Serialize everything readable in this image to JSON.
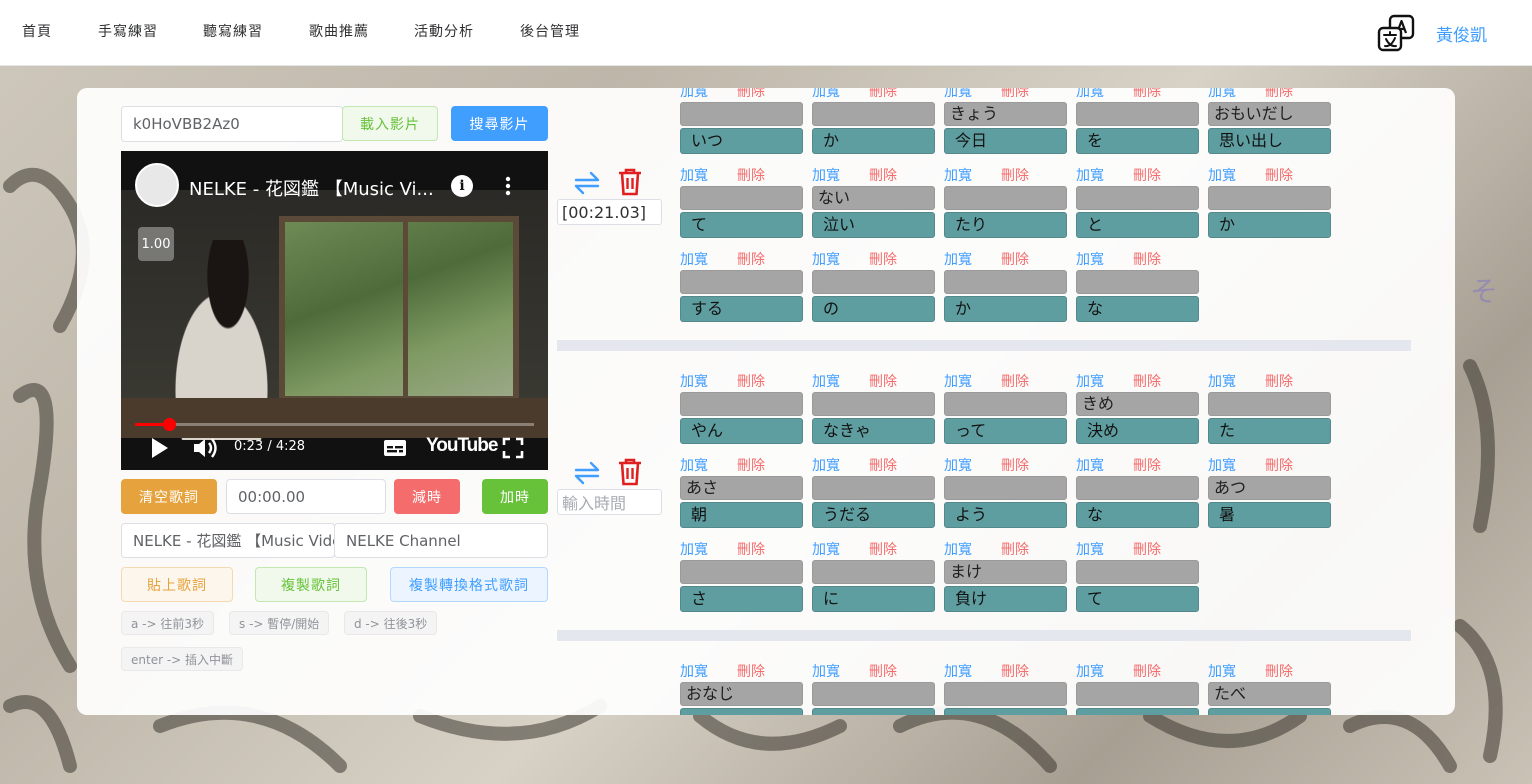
{
  "nav": {
    "items": [
      "首頁",
      "手寫練習",
      "聽寫練習",
      "歌曲推薦",
      "活動分析",
      "後台管理"
    ],
    "user": "黃俊凱"
  },
  "video_controls": {
    "video_id": "k0HoVBB2Az0",
    "load_label": "載入影片",
    "search_label": "搜尋影片",
    "clear_label": "清空歌詞",
    "time_value": "00:00.00",
    "minus_label": "減時",
    "plus_label": "加時",
    "song_title": "NELKE - 花図鑑 【Music Video】",
    "channel": "NELKE Channel",
    "paste_label": "貼上歌詞",
    "copy_label": "複製歌詞",
    "copy_format_label": "複製轉換格式歌詞",
    "shortcuts": [
      "a -> 往前3秒",
      "s -> 暫停/開始",
      "d -> 往後3秒",
      "enter -> 插入中斷"
    ]
  },
  "player": {
    "title": "NELKE - 花図鑑 【Music Vi...",
    "speed": "1.00",
    "time": "0:23 / 4:28",
    "logo": "YouTube",
    "progress_fraction": 0.086
  },
  "lyrics": {
    "widen_label": "加寬",
    "delete_label": "刪除",
    "sections": [
      {
        "time": "[00:21.03]",
        "time_placeholder": "",
        "rows": [
          [
            {
              "reading": "",
              "word": "いつ"
            },
            {
              "reading": "",
              "word": "か"
            },
            {
              "reading": "きょう",
              "word": "今日"
            },
            {
              "reading": "",
              "word": "を"
            },
            {
              "reading": "おもいだし",
              "word": "思い出し"
            }
          ],
          [
            {
              "reading": "",
              "word": "て"
            },
            {
              "reading": "ない",
              "word": "泣い"
            },
            {
              "reading": "",
              "word": "たり"
            },
            {
              "reading": "",
              "word": "と"
            },
            {
              "reading": "",
              "word": "か"
            }
          ],
          [
            {
              "reading": "",
              "word": "する"
            },
            {
              "reading": "",
              "word": "の"
            },
            {
              "reading": "",
              "word": "か"
            },
            {
              "reading": "",
              "word": "な"
            }
          ]
        ]
      },
      {
        "time": "",
        "time_placeholder": "輸入時間",
        "rows": [
          [
            {
              "reading": "",
              "word": "やん"
            },
            {
              "reading": "",
              "word": "なきゃ"
            },
            {
              "reading": "",
              "word": "って"
            },
            {
              "reading": "きめ",
              "word": "決め"
            },
            {
              "reading": "",
              "word": "た"
            }
          ],
          [
            {
              "reading": "あさ",
              "word": "朝"
            },
            {
              "reading": "",
              "word": "うだる"
            },
            {
              "reading": "",
              "word": "よう"
            },
            {
              "reading": "",
              "word": "な"
            },
            {
              "reading": "あつ",
              "word": "暑"
            }
          ],
          [
            {
              "reading": "",
              "word": "さ"
            },
            {
              "reading": "",
              "word": "に"
            },
            {
              "reading": "まけ",
              "word": "負け"
            },
            {
              "reading": "",
              "word": "て"
            }
          ]
        ]
      },
      {
        "time": "",
        "time_placeholder": "",
        "rows": [
          [
            {
              "reading": "おなじ",
              "word": ""
            },
            {
              "reading": "",
              "word": ""
            },
            {
              "reading": "",
              "word": ""
            },
            {
              "reading": "",
              "word": ""
            },
            {
              "reading": "たべ",
              "word": ""
            }
          ]
        ]
      }
    ]
  },
  "colors": {
    "accent": "#409eff",
    "danger": "#f56c6c",
    "reading_cell": "#a5a5a5",
    "word_cell": "#5f9ea0"
  }
}
